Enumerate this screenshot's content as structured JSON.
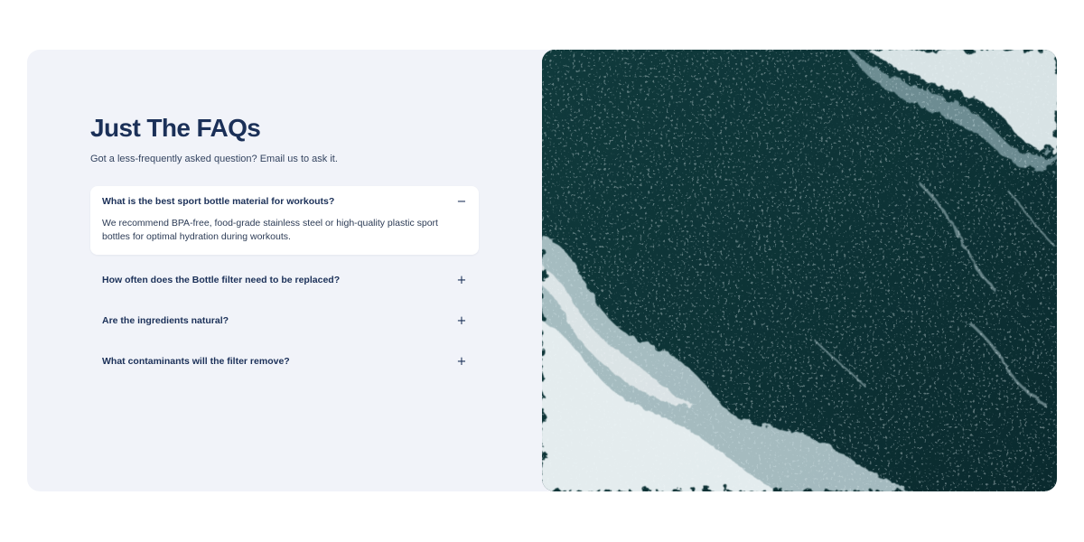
{
  "faq": {
    "title": "Just The FAQs",
    "subtitle": "Got a less-frequently asked question? Email us to ask it.",
    "items": [
      {
        "question": "What is the best sport bottle material for workouts?",
        "answer": "We recommend BPA-free, food-grade stainless steel or high-quality plastic sport bottles for optimal hydration during workouts.",
        "toggle": "−",
        "expanded": true
      },
      {
        "question": "How often does the Bottle filter need to be replaced?",
        "toggle": "+",
        "expanded": false
      },
      {
        "question": "Are the ingredients natural?",
        "toggle": "+",
        "expanded": false
      },
      {
        "question": "What contaminants will the filter remove?",
        "toggle": "+",
        "expanded": false
      }
    ]
  },
  "image": {
    "subject": "ocean-waves-aerial-photo"
  },
  "colors": {
    "heading": "#1b3058",
    "panel": "#f1f3f9",
    "card": "#ffffff",
    "ocean": "#0e3535"
  }
}
